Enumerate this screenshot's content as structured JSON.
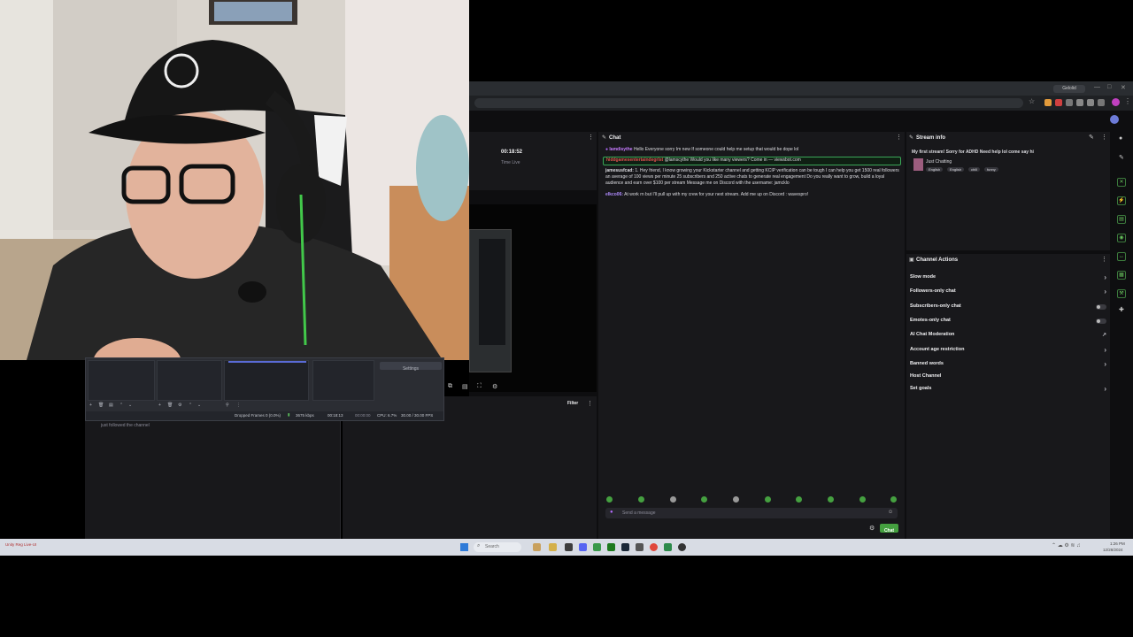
{
  "browser": {
    "tab_label": "Gelolid",
    "window_controls": [
      "—",
      "□",
      "✕"
    ]
  },
  "session": {
    "timer": "00:18:52",
    "timer_label": "Time Live"
  },
  "chat": {
    "title": "Chat",
    "messages": [
      {
        "user": "Iamdisythe",
        "text": "Hello Everyone sorry Im new If someone could help me setup that would be dope lol",
        "user_color": "#c67bff"
      },
      {
        "user": "hiddgamesentertaindegrlst",
        "text": "@lamscythe Would you like many viewers? Come in — viewsbot.com",
        "user_color": "#e05050",
        "highlighted": true
      },
      {
        "user": "jamesusfcad:",
        "text": "1. Hey friend, I know growing your Kickstarter channel and getting KCIP verification can be tough I can help you get 1500 real followers an average of 100 views per minute 25 subscribers and 250 active chats to generate real engagement Do you really want to grow, build a loyal audience and earn over $100 per stream Message me on Discord with the username: jamcklo",
        "user_color": "#dedee3"
      },
      {
        "user": "elkco06:",
        "text": "At work rn but I'll pull up with my crew for your next stream. Add me up on Discord : wavespro!",
        "user_color": "#b08cff"
      }
    ],
    "input_placeholder": "Send a message",
    "send_button": "Chat"
  },
  "stream_info": {
    "title": "Stream info",
    "stream_title": "My first stream! Sorry for ADHD Need help lol come say hi",
    "category": "Just Chatting",
    "tags": [
      "English",
      "English",
      "chill",
      "funny"
    ]
  },
  "channel_actions": {
    "title": "Channel Actions",
    "items": [
      {
        "label": "Slow mode",
        "control": "chevron"
      },
      {
        "label": "Followers-only chat",
        "control": "chevron"
      },
      {
        "label": "Subscribers-only chat",
        "control": "toggle"
      },
      {
        "label": "Emotes-only chat",
        "control": "toggle"
      },
      {
        "label": "AI Chat Moderation",
        "control": "external"
      },
      {
        "label": "Account age restriction",
        "control": "chevron"
      },
      {
        "label": "Banned words",
        "control": "chevron"
      },
      {
        "label": "Host Channel",
        "control": "none"
      },
      {
        "label": "Set goals",
        "control": "chevron"
      }
    ]
  },
  "activity": {
    "followed_text": "just followed the channel",
    "filter_label": "Filter"
  },
  "obs": {
    "settings_button": "Settings",
    "status": {
      "dropped_frames": "Dropped Frames 0 (0.0%)",
      "bitrate": "3675 kbps",
      "stream_time": "00:18:13",
      "rec_time": "00:00:00",
      "cpu": "CPU: 6.7%",
      "fps": "30.00 / 30.00 FPS"
    }
  },
  "taskbar": {
    "search_placeholder": "Search",
    "notification": "Unity Reg Live-UI",
    "time": "1:26 PM",
    "date": "12/28/2024"
  }
}
